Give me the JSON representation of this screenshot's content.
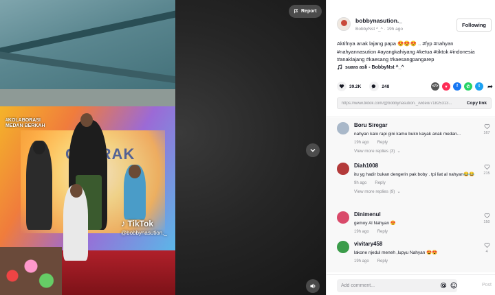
{
  "video": {
    "report_label": "Report",
    "watermark_brand": "TikTok",
    "watermark_user": "@bobbynasution._",
    "banner_line1": "#KOLABORASI",
    "banner_line2": "MEDAN BERKAH",
    "banner_big": "GEBRAK"
  },
  "author": {
    "username": "bobbynasution._",
    "display_name": "BobbyNst ^_^",
    "separator": " · ",
    "posted": "19h ago",
    "follow_label": "Following"
  },
  "caption": {
    "text": "Aktifnya anak lajang papa 😍😍😍 .. ",
    "hashtags": "#fyp #nahyan #nahyannasution #ayangkahiyang #ketua #tiktok #indonesia #anaklajang #kaesang #kaesangpangarep"
  },
  "music": {
    "label": "suara asli - BobbyNst ^_^"
  },
  "stats": {
    "likes": "39.2K",
    "comments": "248"
  },
  "link": {
    "url": "https://www.tiktok.com/@bobbynasution._/video/71825313...",
    "copy_label": "Copy link"
  },
  "comments": [
    {
      "user": "Boru Siregar",
      "text": "nahyan kalo rapi gini kamu bukn kayak anak medan...",
      "time": "19h ago",
      "reply": "Reply",
      "likes": "167",
      "view_more": "View more replies (3)",
      "avatar_color": "#a9b8c9"
    },
    {
      "user": "Diah1008",
      "text": "itu yg hadir bukan dengerin pak boby . tpi liat al nahyan😂😂",
      "time": "9h ago",
      "reply": "Reply",
      "likes": "215",
      "view_more": "View more replies (9)",
      "avatar_color": "#b33a3a"
    },
    {
      "user": "Dinimenul",
      "text": "gemoy Al Nahyan 😍",
      "time": "19h ago",
      "reply": "Reply",
      "likes": "150",
      "view_more": "",
      "avatar_color": "#d94a6a"
    },
    {
      "user": "vivitary458",
      "text": "lakone njedul meneh ,lupyu Nahyan 😍😍",
      "time": "19h ago",
      "reply": "Reply",
      "likes": "4",
      "view_more": "",
      "avatar_color": "#3b9c4a"
    }
  ],
  "composer": {
    "placeholder": "Add comment...",
    "post_label": "Post"
  },
  "colors": {
    "accent": "#fe2c55",
    "text": "#161823",
    "muted": "#8a8b91"
  }
}
